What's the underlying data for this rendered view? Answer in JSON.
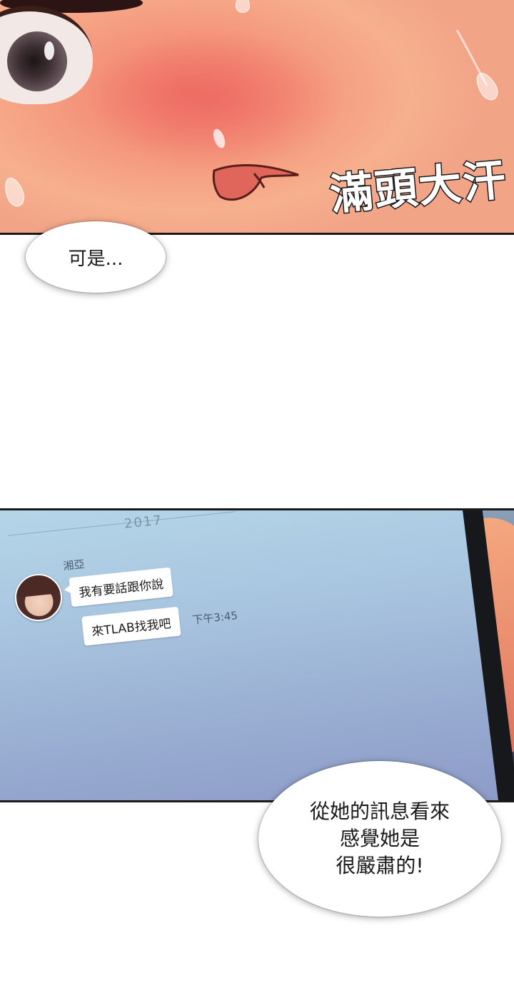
{
  "panel1": {
    "sfx": "滿頭大汗"
  },
  "bubble1": {
    "text": "可是..."
  },
  "phone": {
    "date_partial": "2017",
    "sender": "湘亞",
    "messages": [
      {
        "text": "我有要話跟你說"
      },
      {
        "text": "來TLAB找我吧"
      }
    ],
    "time": "下午3:45"
  },
  "bubble2": {
    "lines": [
      "從她的訊息看來",
      "感覺她是",
      "很嚴肅的!"
    ]
  }
}
